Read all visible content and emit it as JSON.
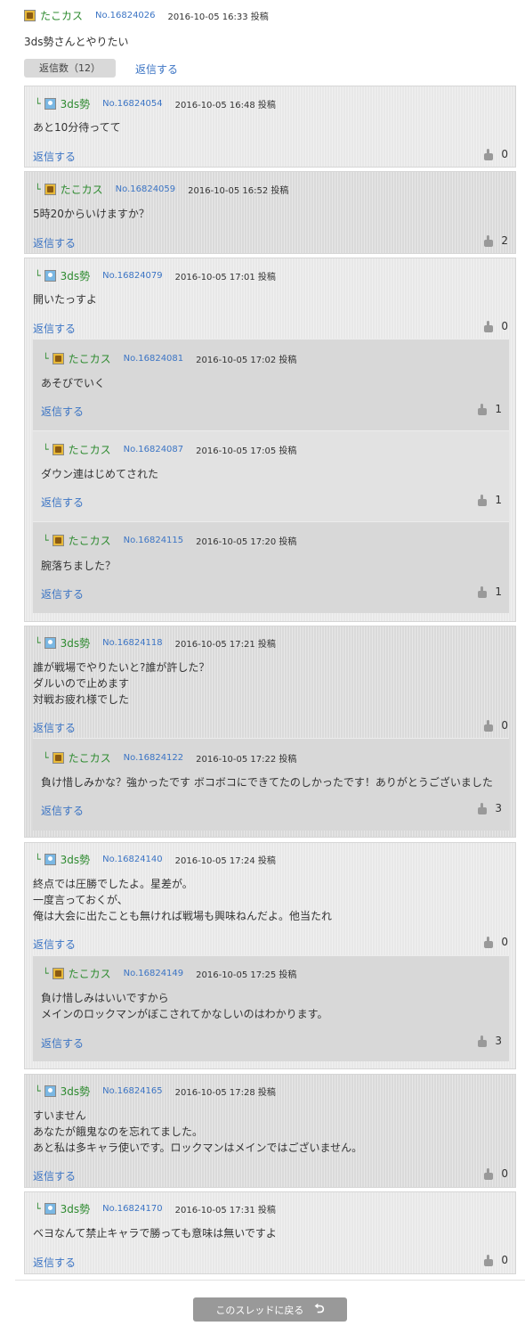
{
  "post": {
    "user": "たこカス",
    "no": "No.16824026",
    "date": "2016-10-05 16:33 投稿",
    "body": "3ds勢さんとやりたい",
    "reply_count": "返信数（12）",
    "reply_link": "返信する"
  },
  "replies": [
    {
      "user": "3ds勢",
      "no": "No.16824054",
      "date": "2016-10-05 16:48 投稿",
      "lines": [
        "あと10分待ってて"
      ],
      "reply": "返信する",
      "likes": "0"
    },
    {
      "user": "たこカス",
      "no": "No.16824059",
      "date": "2016-10-05 16:52 投稿",
      "lines": [
        "5時20からいけますか？"
      ],
      "reply": "返信する",
      "likes": "2"
    },
    {
      "user": "3ds勢",
      "no": "No.16824079",
      "date": "2016-10-05 17:01 投稿",
      "lines": [
        "開いたっすよ"
      ],
      "reply": "返信する",
      "likes": "0",
      "children": [
        {
          "user": "たこカス",
          "no": "No.16824081",
          "date": "2016-10-05 17:02 投稿",
          "lines": [
            "あそびでいく"
          ],
          "reply": "返信する",
          "likes": "1"
        },
        {
          "user": "たこカス",
          "no": "No.16824087",
          "date": "2016-10-05 17:05 投稿",
          "lines": [
            "ダウン連はじめてされた"
          ],
          "reply": "返信する",
          "likes": "1"
        },
        {
          "user": "たこカス",
          "no": "No.16824115",
          "date": "2016-10-05 17:20 投稿",
          "lines": [
            "腕落ちました？"
          ],
          "reply": "返信する",
          "likes": "1"
        }
      ]
    },
    {
      "user": "3ds勢",
      "no": "No.16824118",
      "date": "2016-10-05 17:21 投稿",
      "lines": [
        "誰が戦場でやりたいと?誰が許した？",
        "ダルいので止めます",
        "対戦お疲れ様でした"
      ],
      "reply": "返信する",
      "likes": "0",
      "children": [
        {
          "user": "たこカス",
          "no": "No.16824122",
          "date": "2016-10-05 17:22 投稿",
          "lines": [
            "負け惜しみかな？強かったです ボコボコにできてたのしかったです！ありがとうございました"
          ],
          "reply": "返信する",
          "likes": "3"
        }
      ]
    },
    {
      "user": "3ds勢",
      "no": "No.16824140",
      "date": "2016-10-05 17:24 投稿",
      "lines": [
        "終点では圧勝でしたよ。星差が。",
        "一度言っておくが、",
        "俺は大会に出たことも無ければ戦場も興味ねんだよ。他当たれ"
      ],
      "reply": "返信する",
      "likes": "0",
      "children": [
        {
          "user": "たこカス",
          "no": "No.16824149",
          "date": "2016-10-05 17:25 投稿",
          "lines": [
            "負け惜しみはいいですから",
            "メインのロックマンがぼこされてかなしいのはわかります。"
          ],
          "reply": "返信する",
          "likes": "3"
        }
      ]
    },
    {
      "user": "3ds勢",
      "no": "No.16824165",
      "date": "2016-10-05 17:28 投稿",
      "lines": [
        "すいません",
        "あなたが餓鬼なのを忘れてました。",
        "あと私は多キャラ使いです。ロックマンはメインではございません。"
      ],
      "reply": "返信する",
      "likes": "0"
    },
    {
      "user": "3ds勢",
      "no": "No.16824170",
      "date": "2016-10-05 17:31 投稿",
      "lines": [
        "ベヨなんて禁止キャラで勝っても意味は無いですよ"
      ],
      "reply": "返信する",
      "likes": "0"
    }
  ],
  "footer": {
    "back_button": "このスレッドに戻る",
    "back_icon": "return-arrow-icon"
  }
}
